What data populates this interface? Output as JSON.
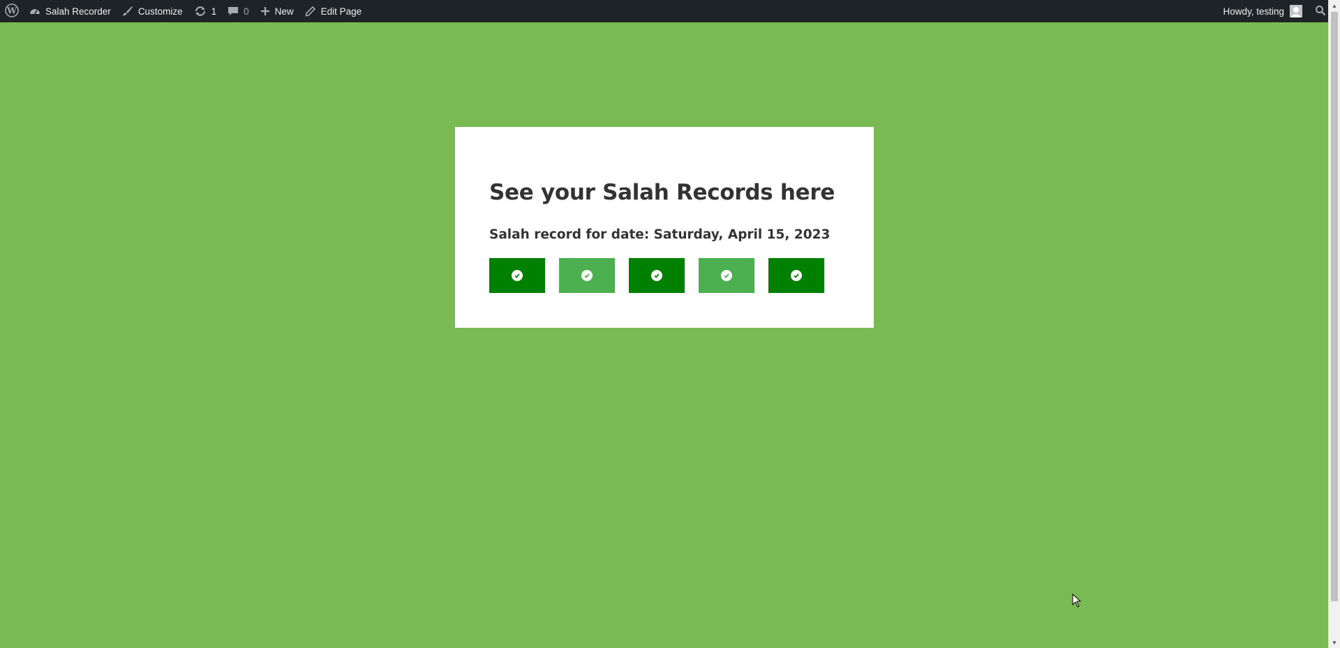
{
  "adminbar": {
    "site_name": "Salah Recorder",
    "customize": "Customize",
    "updates_count": "1",
    "comments_count": "0",
    "new_label": "New",
    "edit_page": "Edit Page",
    "howdy": "Howdy, testing"
  },
  "card": {
    "title": "See your Salah Records here",
    "date_line": "Salah record for date: Saturday, April 15, 2023",
    "prayers": [
      {
        "status": "checked",
        "color": "#008000"
      },
      {
        "status": "checked",
        "color": "#4caf50"
      },
      {
        "status": "checked",
        "color": "#008000"
      },
      {
        "status": "checked",
        "color": "#4caf50"
      },
      {
        "status": "checked",
        "color": "#008000"
      }
    ]
  },
  "colors": {
    "page_background": "#79ba53",
    "adminbar": "#1d2327",
    "dark_green": "#008000",
    "light_green": "#4caf50"
  }
}
